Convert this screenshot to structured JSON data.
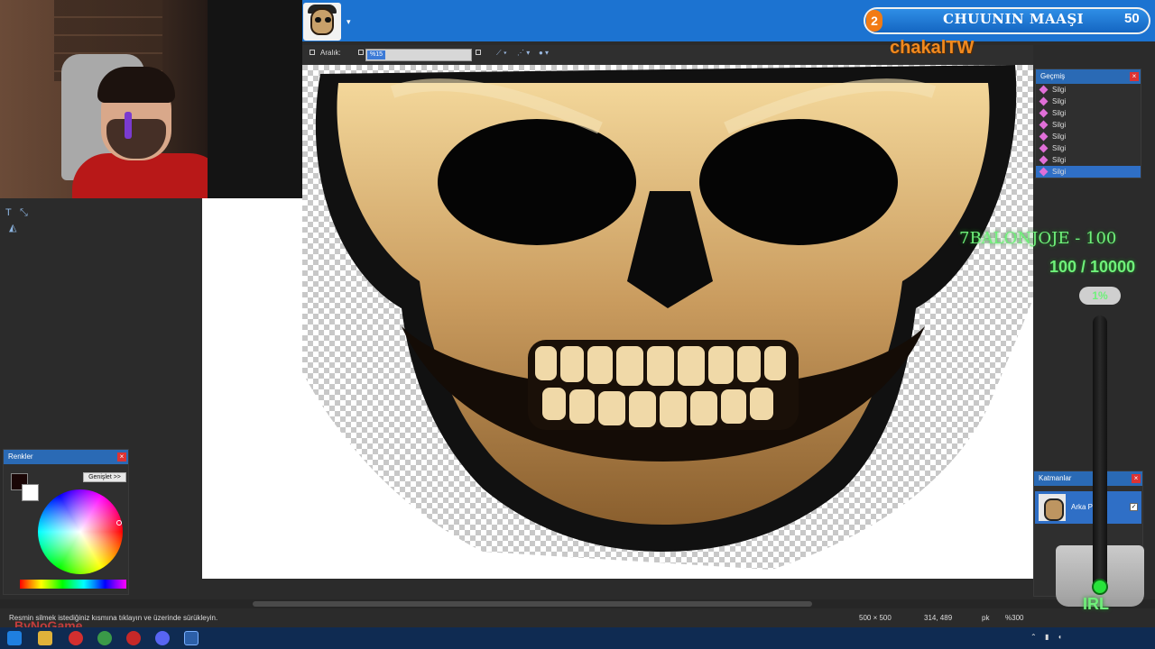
{
  "window": {
    "pin_glyph": "▾"
  },
  "toolbar": {
    "spacing_label": "Aralık:",
    "spacing_value": "%15"
  },
  "history_panel": {
    "title": "Geçmiş",
    "items": [
      "Silgi",
      "Silgi",
      "Silgi",
      "Silgi",
      "Silgi",
      "Silgi",
      "Silgi",
      "Silgi"
    ],
    "close": "×"
  },
  "colors_panel": {
    "title": "Renkler",
    "expand_label": "Genişlet >>",
    "close": "×",
    "primary": "#1a0606",
    "secondary": "#ffffff"
  },
  "layers_panel": {
    "title": "Katmanlar",
    "layer_name": "Arka P",
    "close": "×"
  },
  "status": {
    "hint": "Resmin silmek istediğiniz kısmına tıklayın ve üzerinde sürükleyin.",
    "image_size": "500 × 500",
    "cursor_pos": "314, 489",
    "unit": "pk",
    "zoom": "%300"
  },
  "overlay": {
    "goal_number": "2",
    "goal_title": "CHUUNIN MAAŞI",
    "goal_count": "50",
    "channel_name": "chakalTW",
    "donation_line": "7BALONJOJE - 100",
    "progress_text": "100 / 10000",
    "progress_percent": "1%",
    "progress_fraction": 0.01,
    "irl_label": "IRL",
    "watermark": "ByNoGame"
  },
  "colors": {
    "titlebar": "#1c73d1",
    "accent": "#2f6fc6",
    "goal_orange": "#f27b14",
    "channel_orange": "#f0891f",
    "overlay_green": "#6ff07a"
  }
}
